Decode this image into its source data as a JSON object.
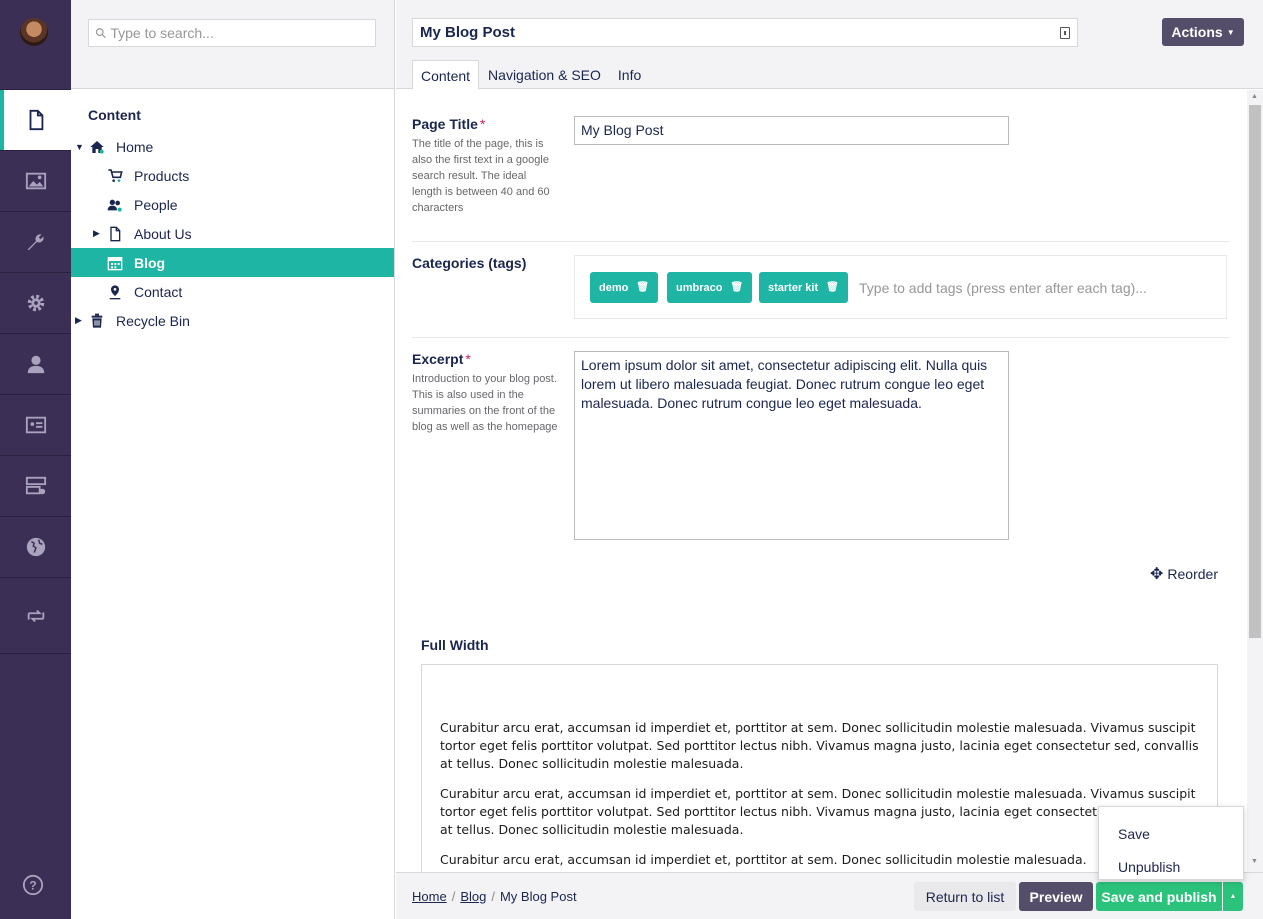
{
  "search": {
    "placeholder": "Type to search..."
  },
  "tree": {
    "heading": "Content",
    "nodes": [
      {
        "label": "Home",
        "icon": "home-icon"
      },
      {
        "label": "Products",
        "icon": "cart-icon"
      },
      {
        "label": "People",
        "icon": "people-icon"
      },
      {
        "label": "About Us",
        "icon": "document-icon"
      },
      {
        "label": "Blog",
        "icon": "calendar-icon"
      },
      {
        "label": "Contact",
        "icon": "map-pin-icon"
      },
      {
        "label": "Recycle Bin",
        "icon": "trash-icon"
      }
    ]
  },
  "header": {
    "node_name": "My Blog Post",
    "actions_label": "Actions",
    "tabs": [
      "Content",
      "Navigation & SEO",
      "Info"
    ]
  },
  "properties": {
    "page_title": {
      "label": "Page Title",
      "required_mark": "*",
      "description": "The title of the page, this is also the first text in a google search result. The ideal length is between 40 and 60 characters",
      "value": "My Blog Post"
    },
    "categories": {
      "label": "Categories (tags)",
      "tags": [
        "demo",
        "umbraco",
        "starter kit"
      ],
      "placeholder": "Type to add tags (press enter after each tag)..."
    },
    "excerpt": {
      "label": "Excerpt",
      "required_mark": "*",
      "description": "Introduction to your blog post. This is also used in the summaries on the front of the blog as well as the homepage",
      "value": "Lorem ipsum dolor sit amet, consectetur adipiscing elit. Nulla quis lorem ut libero malesuada feugiat. Donec rutrum congue leo eget malesuada. Donec rutrum congue leo eget malesuada."
    }
  },
  "reorder_label": "Reorder",
  "full_width": {
    "label": "Full Width",
    "paragraphs": [
      "Curabitur arcu erat, accumsan id imperdiet et, porttitor at sem. Donec sollicitudin molestie malesuada. Vivamus suscipit tortor eget felis porttitor volutpat. Sed porttitor lectus nibh. Vivamus magna justo, lacinia eget consectetur sed, convallis at tellus. Donec sollicitudin molestie malesuada.",
      "Curabitur arcu erat, accumsan id imperdiet et, porttitor at sem. Donec sollicitudin molestie malesuada. Vivamus suscipit tortor eget felis porttitor volutpat. Sed porttitor lectus nibh. Vivamus magna justo, lacinia eget consectetur sed, convallis at tellus. Donec sollicitudin molestie malesuada.",
      "Curabitur arcu erat, accumsan id imperdiet et, porttitor at sem. Donec sollicitudin molestie malesuada."
    ]
  },
  "footer": {
    "breadcrumb": [
      "Home",
      "Blog",
      "My Blog Post"
    ],
    "return_label": "Return to list",
    "preview_label": "Preview",
    "publish_label": "Save and publish"
  },
  "publish_menu": [
    "Save",
    "Unpublish"
  ],
  "colors": {
    "rail": "#3b2f56",
    "accent": "#1fb5a4",
    "publish": "#2bc37c",
    "secondary_button": "#544e6b"
  }
}
